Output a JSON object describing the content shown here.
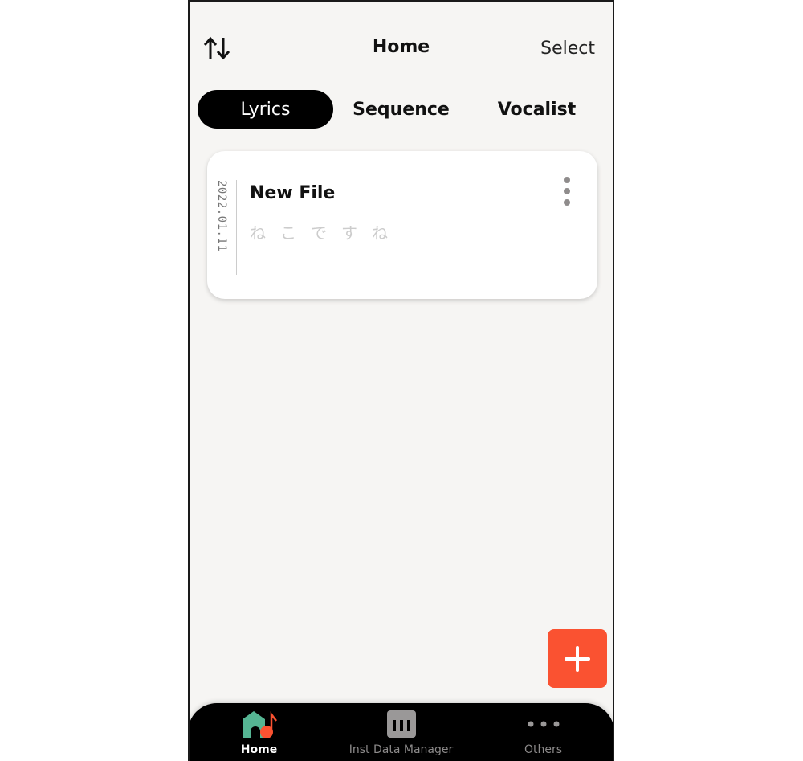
{
  "header": {
    "title": "Home",
    "select_label": "Select",
    "sort_icon": "sort-up-down-icon"
  },
  "tabs": [
    {
      "label": "Lyrics",
      "active": true
    },
    {
      "label": "Sequence",
      "active": false
    },
    {
      "label": "Vocalist",
      "active": false
    }
  ],
  "files": [
    {
      "date": "2022.01.11",
      "title": "New File",
      "lyrics": "ねこですね",
      "menu_icon": "more-vertical-icon"
    }
  ],
  "fab": {
    "icon": "plus-icon",
    "color": "#fa5231"
  },
  "bottom_nav": [
    {
      "label": "Home",
      "icon": "home-music-icon",
      "active": true
    },
    {
      "label": "Inst Data Manager",
      "icon": "piano-keys-icon",
      "active": false
    },
    {
      "label": "Others",
      "icon": "more-horizontal-icon",
      "active": false
    }
  ],
  "colors": {
    "accent": "#fa5231",
    "home_icon_green": "#55b593",
    "background": "#f6f5f3"
  }
}
